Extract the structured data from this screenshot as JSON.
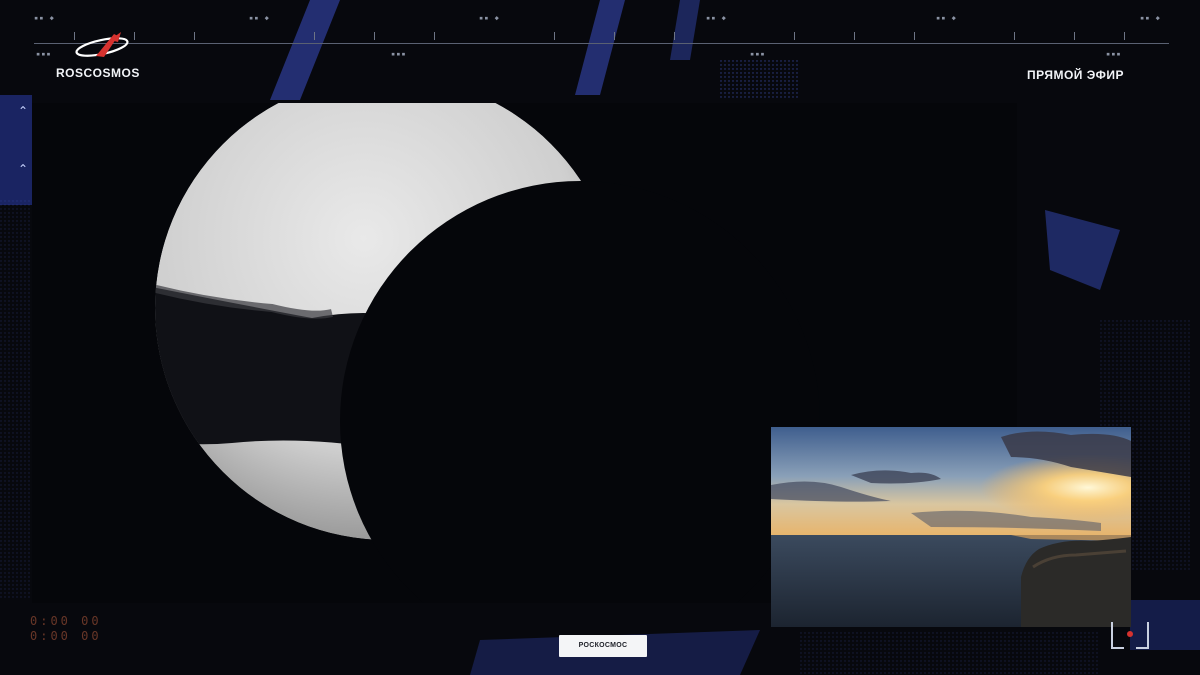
{
  "header": {
    "brand_name": "ROSCOSMOS",
    "live_label": "ПРЯМОЙ ЭФИР"
  },
  "main_feed": {
    "subject": "partial solar eclipse (sun disc partially covered by moon)"
  },
  "pip_feed": {
    "subject": "sunset over sea with cliff"
  },
  "bottom": {
    "badge_text": "РОСКОСМОС",
    "counter_line1": "0:00 00",
    "counter_line2": "0:00 00"
  },
  "icons": {
    "logo": "roscosmos-logo-icon",
    "side_arrow": "chevron-up-icon"
  },
  "colors": {
    "background": "#07080d",
    "accent_blue": "#3a4fbf",
    "brand_red": "#d6322f",
    "counter": "#7a3f2c"
  }
}
